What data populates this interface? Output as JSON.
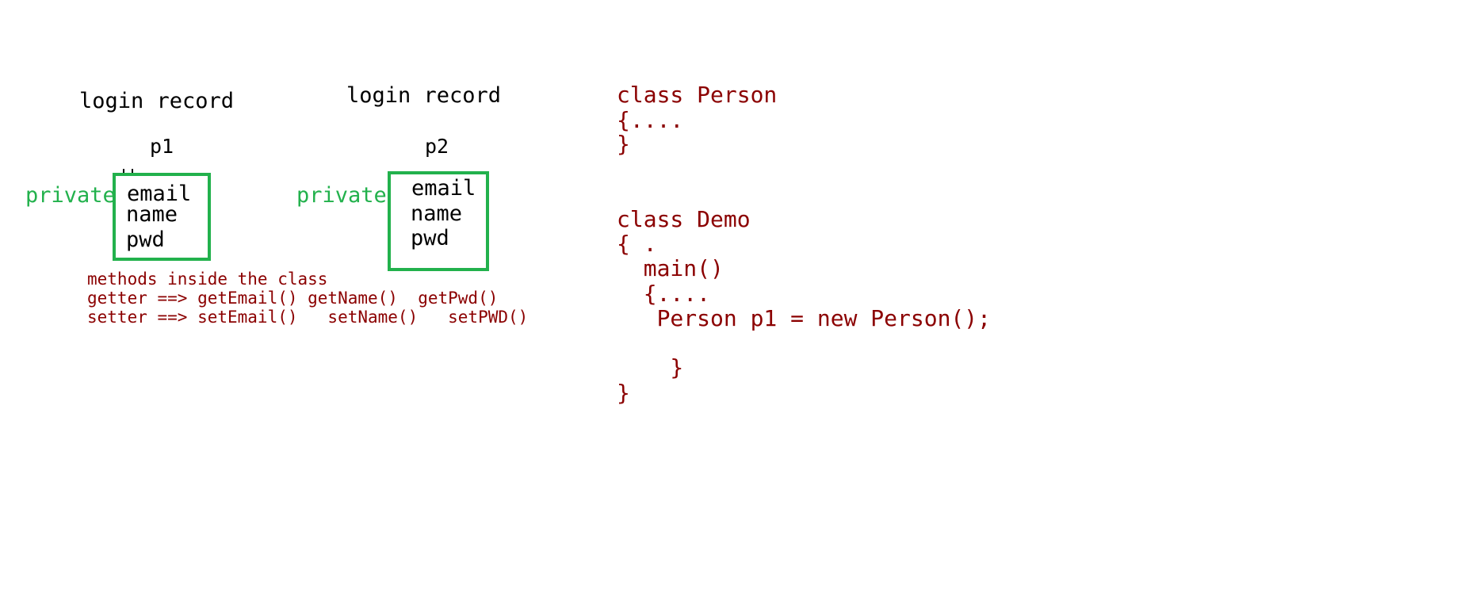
{
  "colors": {
    "access": "#22b14c",
    "box_border": "#22b14c",
    "code": "#8b0000",
    "text": "#000000"
  },
  "record1": {
    "title": "login record",
    "object": "p1",
    "access": "private",
    "fields": [
      "email",
      "name",
      "pwd"
    ]
  },
  "record2": {
    "title": "login record",
    "object": "p2",
    "access": "private",
    "fields": [
      "email",
      "name",
      "pwd"
    ]
  },
  "methods": {
    "line1": "methods inside the class",
    "line2": "getter ==> getEmail() getName()  getPwd()",
    "line3": "setter ==> setEmail()   setName()   setPWD()"
  },
  "code": {
    "lines": [
      "class Person",
      "{....",
      "}",
      "class Demo",
      "{ .",
      "  main()",
      "  {....",
      "   Person p1 = new Person();",
      "    }",
      "}"
    ]
  }
}
